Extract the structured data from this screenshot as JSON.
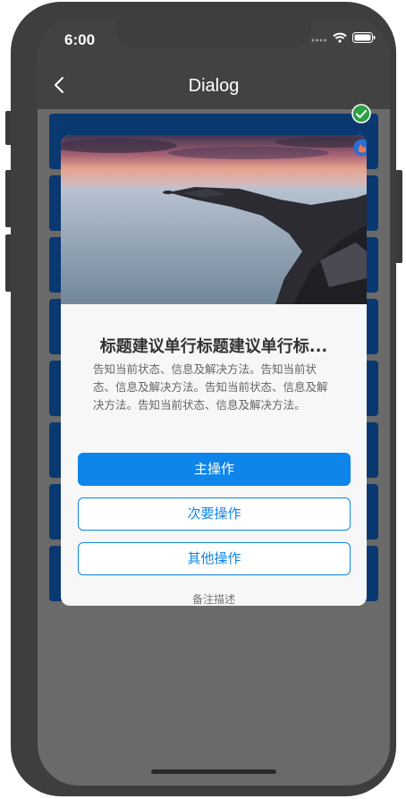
{
  "status_bar": {
    "time": "6:00"
  },
  "nav": {
    "title": "Dialog"
  },
  "list": {
    "item_count": 8
  },
  "dialog": {
    "title": "标题建议单行标题建议单行标...",
    "body": "告知当前状态、信息及解决方法。告知当前状态、信息及解决方法。告知当前状态、信息及解决方法。告知当前状态、信息及解决方法。",
    "primary_label": "主操作",
    "secondary_label": "次要操作",
    "other_label": "其他操作",
    "note": "备注描述"
  },
  "colors": {
    "accent": "#0e85ea",
    "list_item": "#0a3870",
    "overlay": "#6a6a6a",
    "navbar": "#424242",
    "success": "#2ea043"
  },
  "icons": [
    "back-chevron-icon",
    "signal-icon",
    "wifi-icon",
    "battery-icon",
    "check-circle-icon",
    "flame-badge-icon"
  ]
}
